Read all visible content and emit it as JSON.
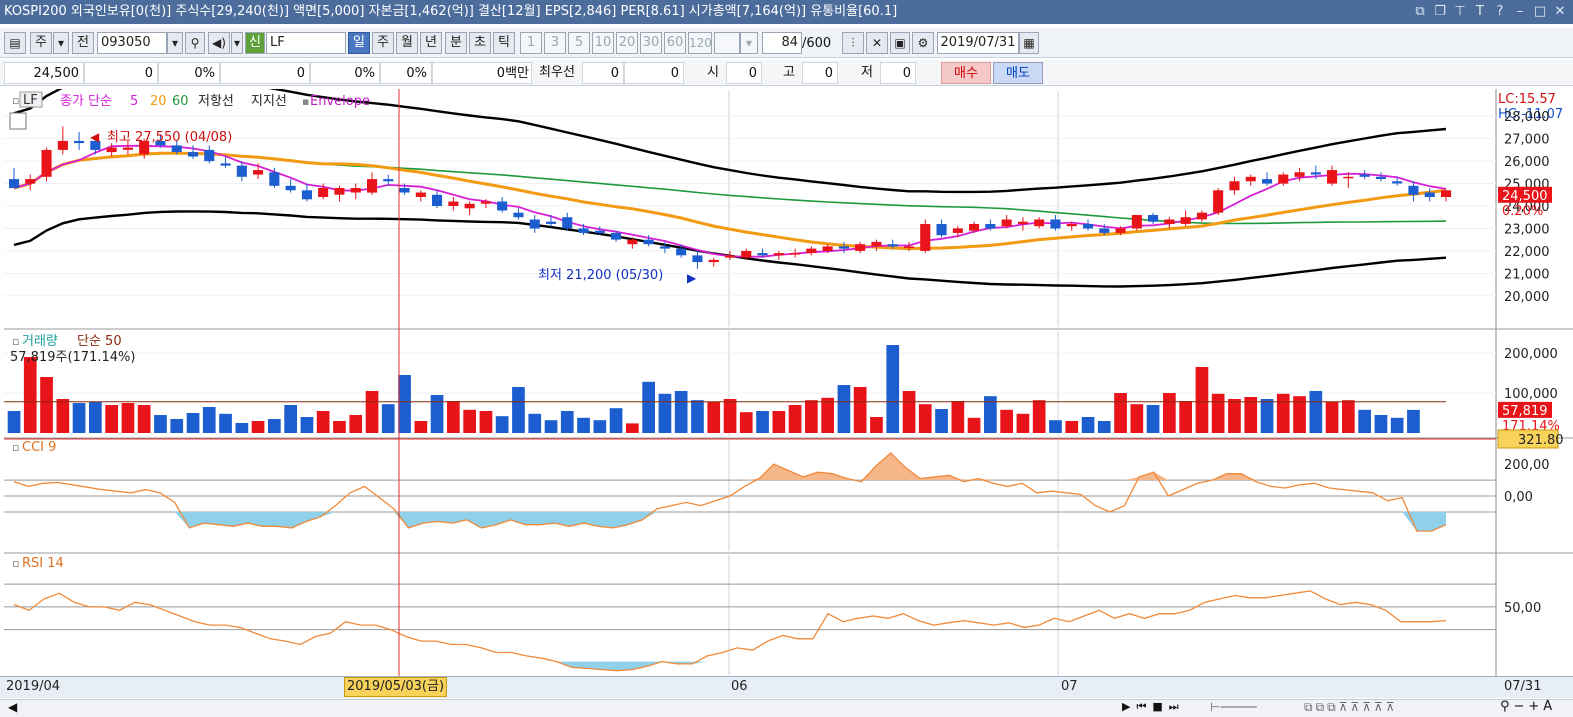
{
  "title": "KOSPI200 외국인보유[0(천)] 주식수[29,240(천)] 액면[5,000] 자본금[1,462(억)] 결산[12월] EPS[2,846] PER[8.61] 시가총액[7,164(억)] 유통비율[60.1]",
  "toolbar": {
    "kind": "주",
    "prev": "전",
    "code": "093050",
    "new_badge": "신",
    "name": "LF",
    "periods": [
      "일",
      "주",
      "월",
      "년",
      "분",
      "초",
      "틱"
    ],
    "active_period": "일",
    "intervals": [
      "1",
      "3",
      "5",
      "10",
      "20",
      "30",
      "60",
      "120"
    ],
    "count": "84",
    "count_total": "/600",
    "date": "2019/07/31"
  },
  "quote": {
    "price": "24,500",
    "change": "0",
    "change_pct": "0%",
    "volume": "0",
    "vol_pct": "0%",
    "rate": "0%",
    "amount": "0백만",
    "best_label": "최우선",
    "bid": "0",
    "ask": "0",
    "open_label": "시",
    "open": "0",
    "high_label": "고",
    "high": "0",
    "low_label": "저",
    "low": "0",
    "buy_label": "매수",
    "sell_label": "매도"
  },
  "price_panel": {
    "legend_name": "LF",
    "legend_ma": "종가 단순",
    "ma_periods": [
      "5",
      "20",
      "60"
    ],
    "legend_resist": "저항선",
    "legend_support": "지지선",
    "legend_env": "Envelope",
    "lc": "LC:15.57",
    "hc": "HC:-11.07",
    "high_note": "최고 27,550 (04/08)",
    "low_note": "최저 21,200 (05/30)",
    "last_price": "24,500",
    "last_pct": "0.20%",
    "y_ticks": [
      "28,000",
      "27,000",
      "26,000",
      "25,000",
      "24,000",
      "23,000",
      "22,000",
      "21,000",
      "20,000"
    ]
  },
  "volume_panel": {
    "legend_name": "거래량",
    "legend_ma": "단순 50",
    "info": "57,819주(171.14%)",
    "last_value": "57,819",
    "last_pct": "171.14%",
    "y_ticks": [
      "200,000",
      "100,000"
    ]
  },
  "cci_panel": {
    "legend": "CCI 9",
    "last_value": "321.80",
    "y_ticks": [
      "200,00",
      "0,00"
    ]
  },
  "rsi_panel": {
    "legend": "RSI 14",
    "y_ticks": [
      "50,00"
    ]
  },
  "x_axis": {
    "labels": [
      "2019/04",
      "06",
      "07"
    ],
    "cursor_label": "2019/05/03(금)",
    "end_label": "07/31"
  },
  "colors": {
    "up": "#e8141a",
    "down": "#1c5dcf",
    "ma5": "#d61fd6",
    "ma20": "#f29a11",
    "ma60": "#1f9a3a",
    "band": "#000000",
    "cursor": "#e03030",
    "cci": "#f08a3a",
    "rsi": "#f08a3a"
  },
  "chart_data": {
    "type": "candlestick",
    "candles": [
      {
        "o": 25200,
        "h": 25700,
        "l": 24800,
        "c": 24800
      },
      {
        "o": 25000,
        "h": 25400,
        "l": 24700,
        "c": 25200
      },
      {
        "o": 25300,
        "h": 26600,
        "l": 25100,
        "c": 26500
      },
      {
        "o": 26500,
        "h": 27550,
        "l": 26300,
        "c": 26900
      },
      {
        "o": 26900,
        "h": 27300,
        "l": 26500,
        "c": 26800
      },
      {
        "o": 26900,
        "h": 27100,
        "l": 26300,
        "c": 26500
      },
      {
        "o": 26400,
        "h": 26800,
        "l": 26200,
        "c": 26600
      },
      {
        "o": 26500,
        "h": 26900,
        "l": 26300,
        "c": 26600
      },
      {
        "o": 26300,
        "h": 27000,
        "l": 26100,
        "c": 26900
      },
      {
        "o": 26900,
        "h": 27200,
        "l": 26600,
        "c": 26700
      },
      {
        "o": 26700,
        "h": 26900,
        "l": 26300,
        "c": 26400
      },
      {
        "o": 26400,
        "h": 26700,
        "l": 26100,
        "c": 26200
      },
      {
        "o": 26500,
        "h": 26700,
        "l": 25900,
        "c": 26000
      },
      {
        "o": 25900,
        "h": 26200,
        "l": 25700,
        "c": 25800
      },
      {
        "o": 25800,
        "h": 26000,
        "l": 25100,
        "c": 25300
      },
      {
        "o": 25400,
        "h": 25900,
        "l": 25200,
        "c": 25600
      },
      {
        "o": 25500,
        "h": 25700,
        "l": 24800,
        "c": 24900
      },
      {
        "o": 24900,
        "h": 25200,
        "l": 24600,
        "c": 24700
      },
      {
        "o": 24700,
        "h": 25000,
        "l": 24200,
        "c": 24300
      },
      {
        "o": 24400,
        "h": 25000,
        "l": 24300,
        "c": 24800
      },
      {
        "o": 24500,
        "h": 24900,
        "l": 24200,
        "c": 24800
      },
      {
        "o": 24600,
        "h": 25000,
        "l": 24300,
        "c": 24800
      },
      {
        "o": 24600,
        "h": 25500,
        "l": 24500,
        "c": 25200
      },
      {
        "o": 25200,
        "h": 25400,
        "l": 24900,
        "c": 25100
      },
      {
        "o": 24800,
        "h": 25000,
        "l": 24500,
        "c": 24600
      },
      {
        "o": 24400,
        "h": 24700,
        "l": 24200,
        "c": 24600
      },
      {
        "o": 24500,
        "h": 24700,
        "l": 23900,
        "c": 24000
      },
      {
        "o": 24000,
        "h": 24400,
        "l": 23800,
        "c": 24200
      },
      {
        "o": 23900,
        "h": 24200,
        "l": 23600,
        "c": 24100
      },
      {
        "o": 24100,
        "h": 24300,
        "l": 23900,
        "c": 24200
      },
      {
        "o": 24200,
        "h": 24400,
        "l": 23700,
        "c": 23800
      },
      {
        "o": 23700,
        "h": 23900,
        "l": 23400,
        "c": 23500
      },
      {
        "o": 23400,
        "h": 23600,
        "l": 22800,
        "c": 23000
      },
      {
        "o": 23300,
        "h": 23600,
        "l": 23100,
        "c": 23200
      },
      {
        "o": 23500,
        "h": 23700,
        "l": 22900,
        "c": 23000
      },
      {
        "o": 23000,
        "h": 23200,
        "l": 22700,
        "c": 22800
      },
      {
        "o": 22900,
        "h": 23100,
        "l": 22700,
        "c": 22800
      },
      {
        "o": 22800,
        "h": 22900,
        "l": 22400,
        "c": 22500
      },
      {
        "o": 22300,
        "h": 22600,
        "l": 22100,
        "c": 22500
      },
      {
        "o": 22500,
        "h": 22700,
        "l": 22200,
        "c": 22300
      },
      {
        "o": 22200,
        "h": 22400,
        "l": 21900,
        "c": 22100
      },
      {
        "o": 22100,
        "h": 22300,
        "l": 21700,
        "c": 21800
      },
      {
        "o": 21800,
        "h": 22000,
        "l": 21200,
        "c": 21500
      },
      {
        "o": 21500,
        "h": 21700,
        "l": 21300,
        "c": 21600
      },
      {
        "o": 21700,
        "h": 22000,
        "l": 21600,
        "c": 21800
      },
      {
        "o": 21700,
        "h": 22100,
        "l": 21600,
        "c": 22000
      },
      {
        "o": 21900,
        "h": 22100,
        "l": 21700,
        "c": 21800
      },
      {
        "o": 21800,
        "h": 22000,
        "l": 21600,
        "c": 21900
      },
      {
        "o": 21900,
        "h": 22100,
        "l": 21700,
        "c": 21900
      },
      {
        "o": 21900,
        "h": 22200,
        "l": 21800,
        "c": 22100
      },
      {
        "o": 22000,
        "h": 22300,
        "l": 21900,
        "c": 22200
      },
      {
        "o": 22200,
        "h": 22400,
        "l": 21900,
        "c": 22100
      },
      {
        "o": 22000,
        "h": 22400,
        "l": 21900,
        "c": 22300
      },
      {
        "o": 22200,
        "h": 22500,
        "l": 22000,
        "c": 22400
      },
      {
        "o": 22300,
        "h": 22500,
        "l": 22100,
        "c": 22200
      },
      {
        "o": 22200,
        "h": 22400,
        "l": 22000,
        "c": 22200
      },
      {
        "o": 22000,
        "h": 23400,
        "l": 21900,
        "c": 23200
      },
      {
        "o": 23200,
        "h": 23400,
        "l": 22600,
        "c": 22700
      },
      {
        "o": 22800,
        "h": 23100,
        "l": 22600,
        "c": 23000
      },
      {
        "o": 22900,
        "h": 23300,
        "l": 22800,
        "c": 23200
      },
      {
        "o": 23200,
        "h": 23400,
        "l": 22900,
        "c": 23000
      },
      {
        "o": 23100,
        "h": 23600,
        "l": 23000,
        "c": 23400
      },
      {
        "o": 23200,
        "h": 23500,
        "l": 22900,
        "c": 23300
      },
      {
        "o": 23100,
        "h": 23500,
        "l": 23000,
        "c": 23400
      },
      {
        "o": 23400,
        "h": 23600,
        "l": 22900,
        "c": 23000
      },
      {
        "o": 23100,
        "h": 23300,
        "l": 22900,
        "c": 23200
      },
      {
        "o": 23200,
        "h": 23400,
        "l": 22900,
        "c": 23000
      },
      {
        "o": 23000,
        "h": 23200,
        "l": 22700,
        "c": 22800
      },
      {
        "o": 22800,
        "h": 23100,
        "l": 22700,
        "c": 23000
      },
      {
        "o": 23000,
        "h": 23600,
        "l": 22900,
        "c": 23600
      },
      {
        "o": 23600,
        "h": 23700,
        "l": 23200,
        "c": 23300
      },
      {
        "o": 23200,
        "h": 23500,
        "l": 23000,
        "c": 23400
      },
      {
        "o": 23200,
        "h": 23800,
        "l": 23100,
        "c": 23500
      },
      {
        "o": 23400,
        "h": 23800,
        "l": 23300,
        "c": 23700
      },
      {
        "o": 23700,
        "h": 24800,
        "l": 23600,
        "c": 24700
      },
      {
        "o": 24700,
        "h": 25300,
        "l": 24500,
        "c": 25100
      },
      {
        "o": 25100,
        "h": 25400,
        "l": 24900,
        "c": 25300
      },
      {
        "o": 25200,
        "h": 25500,
        "l": 24900,
        "c": 25000
      },
      {
        "o": 25000,
        "h": 25500,
        "l": 24900,
        "c": 25400
      },
      {
        "o": 25300,
        "h": 25700,
        "l": 25100,
        "c": 25500
      },
      {
        "o": 25500,
        "h": 25800,
        "l": 25200,
        "c": 25400
      },
      {
        "o": 25000,
        "h": 25800,
        "l": 24900,
        "c": 25600
      },
      {
        "o": 25300,
        "h": 25500,
        "l": 24800,
        "c": 25300
      },
      {
        "o": 25400,
        "h": 25600,
        "l": 25200,
        "c": 25300
      },
      {
        "o": 25300,
        "h": 25500,
        "l": 25100,
        "c": 25200
      },
      {
        "o": 25100,
        "h": 25300,
        "l": 24900,
        "c": 25000
      },
      {
        "o": 24900,
        "h": 25100,
        "l": 24200,
        "c": 24500
      },
      {
        "o": 24600,
        "h": 24800,
        "l": 24200,
        "c": 24400
      },
      {
        "o": 24400,
        "h": 24700,
        "l": 24200,
        "c": 24700
      }
    ],
    "volumes": [
      55000,
      190000,
      140000,
      85000,
      75000,
      78000,
      70000,
      75000,
      70000,
      45000,
      35000,
      50000,
      65000,
      48000,
      25000,
      30000,
      35000,
      70000,
      40000,
      55000,
      30000,
      45000,
      105000,
      72000,
      145000,
      30000,
      95000,
      80000,
      58000,
      55000,
      42000,
      115000,
      48000,
      32000,
      55000,
      38000,
      32000,
      62000,
      24000,
      128000,
      98000,
      105000,
      82000,
      78000,
      85000,
      52000,
      55000,
      55000,
      70000,
      82000,
      88000,
      120000,
      115000,
      40000,
      220000,
      105000,
      72000,
      60000,
      80000,
      38000,
      92000,
      58000,
      48000,
      82000,
      32000,
      30000,
      40000,
      30000,
      100000,
      72000,
      70000,
      100000,
      80000,
      165000,
      98000,
      85000,
      90000,
      85000,
      98000,
      92000,
      105000,
      78000,
      82000,
      58000,
      45000,
      38000,
      57819
    ],
    "vol_ma50": 78000,
    "ylim": [
      19500,
      28500
    ],
    "ylim_volume": [
      0,
      240000
    ],
    "cci": [
      90,
      60,
      80,
      85,
      70,
      55,
      40,
      30,
      20,
      40,
      20,
      -40,
      -200,
      -170,
      -180,
      -190,
      -170,
      -190,
      -190,
      -200,
      -160,
      -130,
      -60,
      20,
      60,
      -10,
      -80,
      -200,
      -170,
      -160,
      -170,
      -150,
      -200,
      -180,
      -150,
      -180,
      -180,
      -170,
      -190,
      -170,
      -190,
      -200,
      -180,
      -150,
      -80,
      -60,
      -40,
      -60,
      -30,
      0,
      60,
      110,
      200,
      160,
      120,
      150,
      140,
      110,
      90,
      190,
      270,
      180,
      110,
      120,
      130,
      90,
      110,
      80,
      60,
      80,
      20,
      30,
      20,
      10,
      -60,
      -100,
      -60,
      120,
      150,
      0,
      40,
      80,
      100,
      140,
      140,
      90,
      60,
      50,
      70,
      80,
      50,
      40,
      30,
      20,
      -30,
      -10,
      -220,
      -220,
      -180
    ],
    "cci_ylim": [
      -320,
      320
    ],
    "rsi": [
      60,
      55,
      65,
      70,
      62,
      58,
      58,
      55,
      62,
      60,
      55,
      50,
      45,
      42,
      42,
      40,
      35,
      30,
      28,
      25,
      32,
      35,
      45,
      42,
      42,
      38,
      32,
      28,
      28,
      25,
      25,
      22,
      18,
      18,
      15,
      13,
      10,
      5,
      4,
      3,
      2,
      3,
      6,
      10,
      8,
      8,
      15,
      18,
      22,
      20,
      28,
      33,
      30,
      30,
      52,
      45,
      48,
      50,
      48,
      52,
      46,
      42,
      44,
      46,
      44,
      42,
      44,
      40,
      42,
      48,
      45,
      50,
      55,
      48,
      52,
      48,
      52,
      52,
      55,
      62,
      65,
      68,
      66,
      66,
      68,
      70,
      72,
      65,
      60,
      62,
      60,
      55,
      45,
      45,
      45,
      46
    ],
    "rsi_ylim": [
      0,
      100
    ]
  }
}
